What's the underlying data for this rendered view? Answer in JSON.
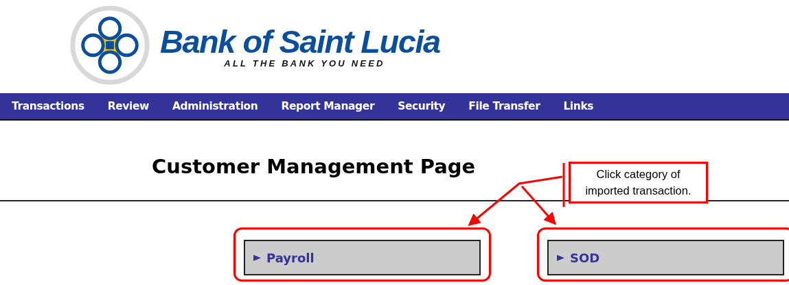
{
  "logo": {
    "name": "Bank of Saint Lucia",
    "tagline": "ALL THE BANK YOU NEED"
  },
  "nav": [
    {
      "label": "Transactions"
    },
    {
      "label": "Review"
    },
    {
      "label": "Administration"
    },
    {
      "label": "Report Manager"
    },
    {
      "label": "Security"
    },
    {
      "label": "File Transfer"
    },
    {
      "label": "Links"
    }
  ],
  "title": "Customer Management Page",
  "callout": {
    "text": "Click category of imported transaction."
  },
  "categories": [
    {
      "label": "Payroll",
      "highlighted": true
    },
    {
      "label": "SOD",
      "highlighted": true
    }
  ]
}
